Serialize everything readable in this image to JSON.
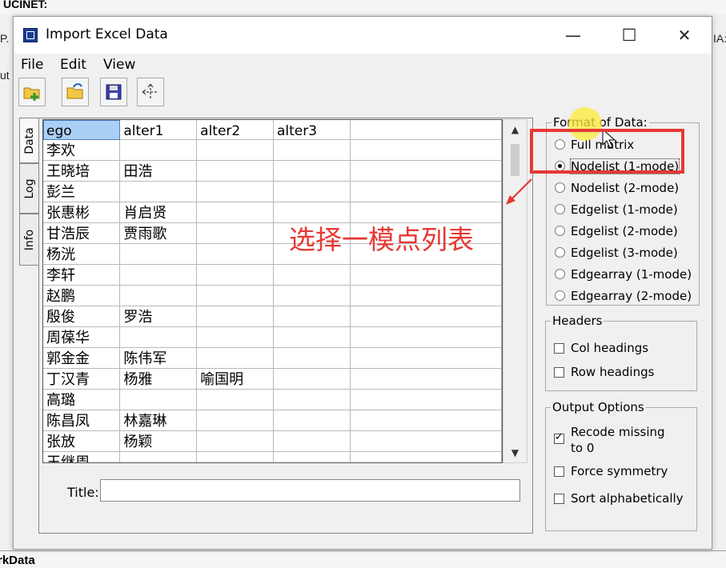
{
  "background": {
    "top_text": "UCINET:",
    "left_edge_a": "P.",
    "left_edge_b": "ut",
    "right_edge": "IA:",
    "bottom_text": "rkData"
  },
  "window": {
    "title": "Import Excel Data",
    "minimize": "—",
    "maximize": "☐",
    "close": "✕"
  },
  "menu": {
    "file": "File",
    "edit": "Edit",
    "view": "View"
  },
  "toolbar": {
    "icons": [
      "new-open-icon",
      "open-folder-icon",
      "save-icon",
      "move-arrows-icon"
    ]
  },
  "tabs": {
    "data": "Data",
    "log": "Log",
    "info": "Info"
  },
  "grid": {
    "headers": [
      "ego",
      "alter1",
      "alter2",
      "alter3",
      ""
    ],
    "rows": [
      [
        "李欢",
        "",
        "",
        ""
      ],
      [
        "王晓培",
        "田浩",
        "",
        ""
      ],
      [
        "彭兰",
        "",
        "",
        ""
      ],
      [
        "张惠彬",
        "肖启贤",
        "",
        ""
      ],
      [
        "甘浩辰",
        "贾雨歌",
        "",
        ""
      ],
      [
        "杨洸",
        "",
        "",
        ""
      ],
      [
        "李轩",
        "",
        "",
        ""
      ],
      [
        "赵鹏",
        "",
        "",
        ""
      ],
      [
        "殷俊",
        "罗浩",
        "",
        ""
      ],
      [
        "周葆华",
        "",
        "",
        ""
      ],
      [
        "郭金金",
        "陈伟军",
        "",
        ""
      ],
      [
        "丁汉青",
        "杨雅",
        "喻国明",
        ""
      ],
      [
        "高璐",
        "",
        "",
        ""
      ],
      [
        "陈昌凤",
        "林嘉琳",
        "",
        ""
      ],
      [
        "张放",
        "杨颖",
        "",
        ""
      ],
      [
        "王继周",
        "",
        "",
        ""
      ]
    ]
  },
  "title_field": {
    "label": "Title:",
    "value": ""
  },
  "format_group": {
    "legend": "Format of Data:",
    "options": [
      {
        "label": "Full matrix",
        "selected": false
      },
      {
        "label": "Nodelist (1-mode)",
        "selected": true
      },
      {
        "label": "Nodelist (2-mode)",
        "selected": false
      },
      {
        "label": "Edgelist (1-mode)",
        "selected": false
      },
      {
        "label": "Edgelist (2-mode)",
        "selected": false
      },
      {
        "label": "Edgelist (3-mode)",
        "selected": false
      },
      {
        "label": "Edgearray (1-mode)",
        "selected": false
      },
      {
        "label": "Edgearray (2-mode)",
        "selected": false
      }
    ]
  },
  "headers_group": {
    "legend": "Headers",
    "options": [
      {
        "label": "Col headings",
        "checked": false
      },
      {
        "label": "Row headings",
        "checked": false
      }
    ]
  },
  "output_group": {
    "legend": "Output Options",
    "options": [
      {
        "label": "Recode missing to 0",
        "line1": "Recode missing",
        "line2": "to 0",
        "checked": true
      },
      {
        "label": "Force symmetry",
        "checked": false
      },
      {
        "label": "Sort alphabetically",
        "checked": false
      }
    ]
  },
  "annotation": {
    "text": "选择一模点列表",
    "color": "#e53935"
  },
  "colors": {
    "highlight": "#e53935",
    "selection": "#aad0f5"
  }
}
